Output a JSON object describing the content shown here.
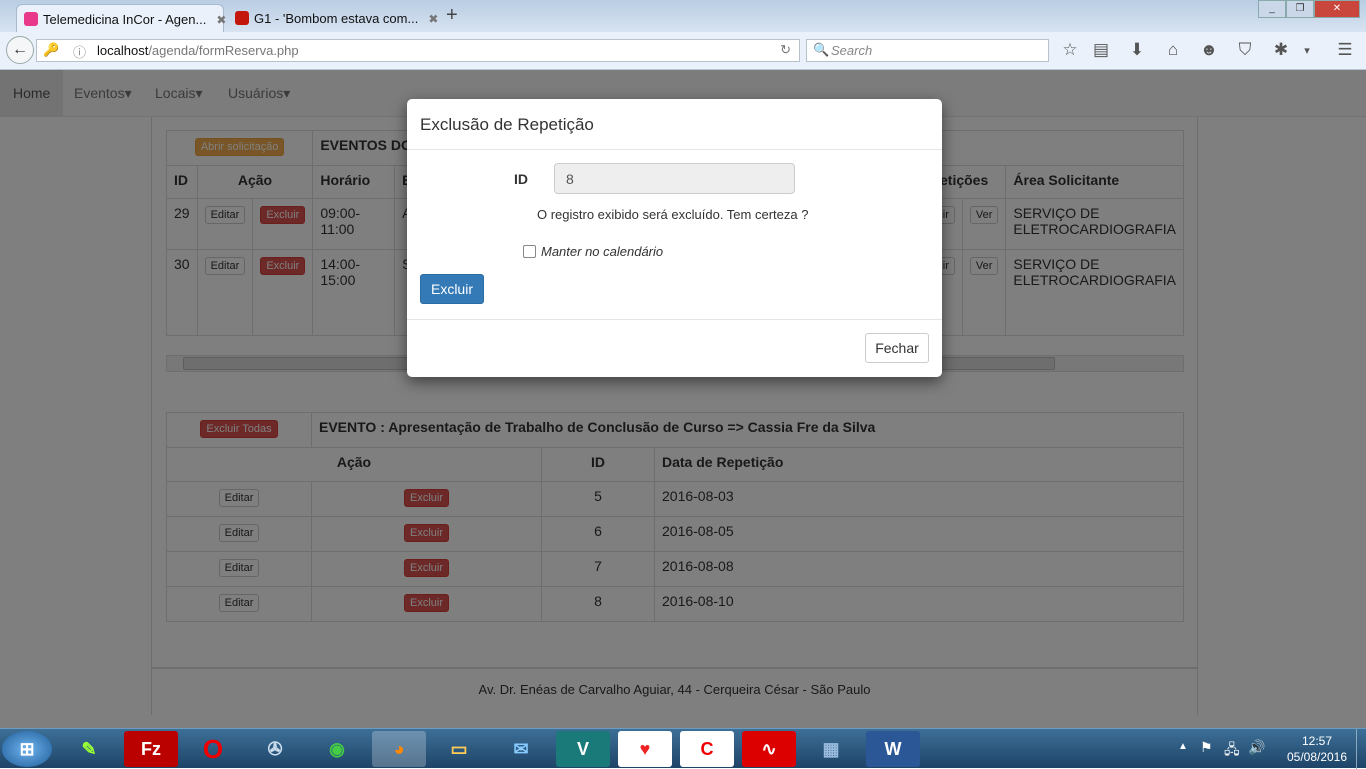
{
  "browser": {
    "tabs": [
      {
        "title": "Telemedicina InCor - Agen...",
        "favicon_color": "#e8398a"
      },
      {
        "title": "G1 - 'Bombom estava com...",
        "favicon_color": "#c4170c"
      }
    ],
    "url_host": "localhost",
    "url_path": "/agenda/formReserva.php",
    "search_placeholder": "Search"
  },
  "nav": {
    "items": [
      "Home",
      "Eventos",
      "Locais",
      "Usuários"
    ]
  },
  "table1": {
    "open_button": "Abrir solicitação",
    "title": "EVENTOS DO D",
    "headers": {
      "id": "ID",
      "acao": "Ação",
      "horario": "Horário",
      "es": "Es",
      "repeticoes": "Repetições",
      "area": "Área Solicitante"
    },
    "rows": [
      {
        "id": "29",
        "edit": "Editar",
        "delete": "Excluir",
        "horario": "09:00-11:00",
        "es": "A",
        "incluir": "Incluir",
        "ver": "Ver",
        "area": "SERVIÇO DE ELETROCARDIOGRAFIA"
      },
      {
        "id": "30",
        "edit": "Editar",
        "delete": "Excluir",
        "horario": "14:00-15:00",
        "es": "S D",
        "incluir": "Incluir",
        "ver": "Ver",
        "area": "SERVIÇO DE ELETROCARDIOGRAFIA"
      }
    ]
  },
  "table2": {
    "delete_all": "Excluir Todas",
    "title": "EVENTO : Apresentação de Trabalho de Conclusão de Curso => Cassia Fre da Silva",
    "headers": {
      "acao": "Ação",
      "id": "ID",
      "data": "Data de Repetição"
    },
    "rows": [
      {
        "edit": "Editar",
        "delete": "Excluir",
        "id": "5",
        "data": "2016-08-03"
      },
      {
        "edit": "Editar",
        "delete": "Excluir",
        "id": "6",
        "data": "2016-08-05"
      },
      {
        "edit": "Editar",
        "delete": "Excluir",
        "id": "7",
        "data": "2016-08-08"
      },
      {
        "edit": "Editar",
        "delete": "Excluir",
        "id": "8",
        "data": "2016-08-10"
      }
    ]
  },
  "footer": "Av. Dr. Enéas de Carvalho Aguiar, 44 - Cerqueira César - São Paulo",
  "modal": {
    "title": "Exclusão de Repetição",
    "id_label": "ID",
    "id_value": "8",
    "message": "O registro exibido será excluído. Tem certeza ?",
    "checkbox_label": "Manter no calendário",
    "checkbox_checked": false,
    "submit": "Excluir",
    "close": "Fechar"
  },
  "taskbar": {
    "time": "12:57",
    "date": "05/08/2016"
  }
}
